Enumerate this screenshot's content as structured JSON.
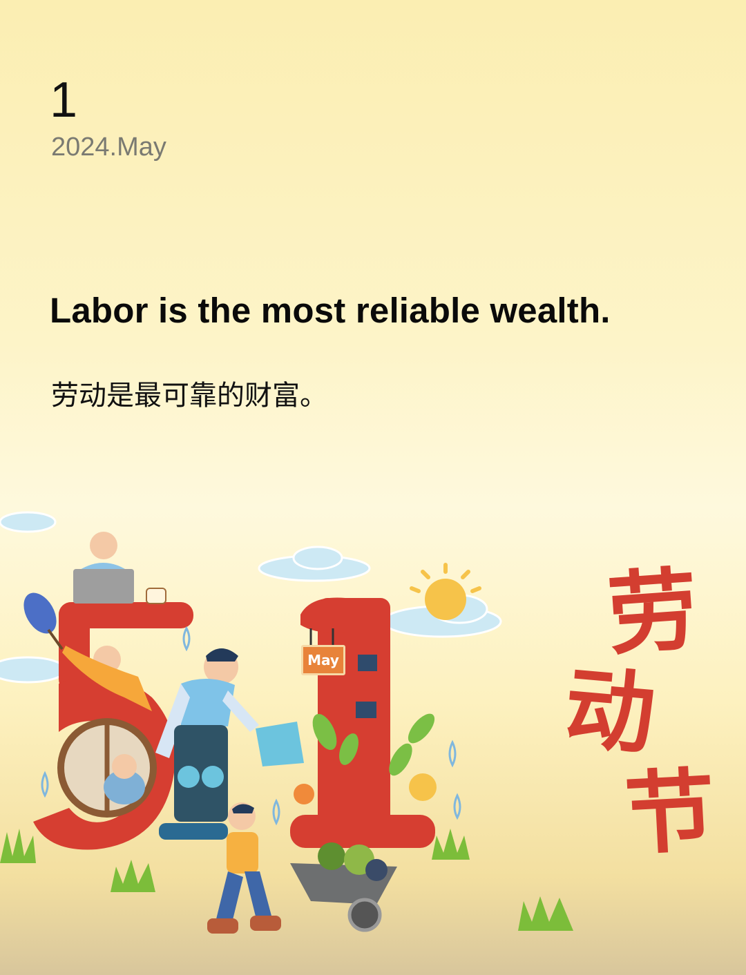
{
  "date": {
    "day": "1",
    "month_year": "2024.May"
  },
  "quote": {
    "english": "Labor is the most reliable wealth.",
    "chinese": "劳动是最可靠的财富。"
  },
  "illustration": {
    "sign_text": "May",
    "holiday_chars": [
      "劳",
      "动",
      "节"
    ],
    "accent_red": "#d33e30",
    "sky_blue": "#cde9f4"
  }
}
